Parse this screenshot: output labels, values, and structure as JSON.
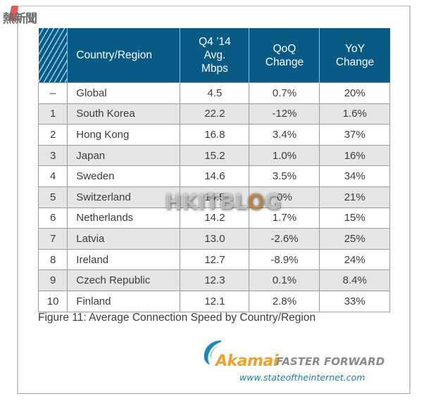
{
  "site_logo": {
    "text": "熱新聞"
  },
  "watermark": {
    "text_pre": "HKITBL",
    "text_o": "O",
    "text_post": "G"
  },
  "table": {
    "headers": {
      "rank": "",
      "country": "Country/Region",
      "avg_line1": "Q4 ’14",
      "avg_line2": "Avg.",
      "avg_line3": "Mbps",
      "qoq_line1": "QoQ",
      "qoq_line2": "Change",
      "yoy_line1": "YoY",
      "yoy_line2": "Change"
    },
    "rows": [
      {
        "rank": "–",
        "country": "Global",
        "mbps": "4.5",
        "qoq": "0.7%",
        "yoy": "20%"
      },
      {
        "rank": "1",
        "country": "South Korea",
        "mbps": "22.2",
        "qoq": "-12%",
        "yoy": "1.6%"
      },
      {
        "rank": "2",
        "country": "Hong Kong",
        "mbps": "16.8",
        "qoq": "3.4%",
        "yoy": "37%"
      },
      {
        "rank": "3",
        "country": "Japan",
        "mbps": "15.2",
        "qoq": "1.0%",
        "yoy": "16%"
      },
      {
        "rank": "4",
        "country": "Sweden",
        "mbps": "14.6",
        "qoq": "3.5%",
        "yoy": "34%"
      },
      {
        "rank": "5",
        "country": "Switzerland",
        "mbps": "14.5",
        "qoq": "0%",
        "yoy": "21%"
      },
      {
        "rank": "6",
        "country": "Netherlands",
        "mbps": "14.2",
        "qoq": "1.7%",
        "yoy": "15%"
      },
      {
        "rank": "7",
        "country": "Latvia",
        "mbps": "13.0",
        "qoq": "-2.6%",
        "yoy": "25%"
      },
      {
        "rank": "8",
        "country": "Ireland",
        "mbps": "12.7",
        "qoq": "-8.9%",
        "yoy": "24%"
      },
      {
        "rank": "9",
        "country": "Czech Republic",
        "mbps": "12.3",
        "qoq": "0.1%",
        "yoy": "8.4%"
      },
      {
        "rank": "10",
        "country": "Finland",
        "mbps": "12.1",
        "qoq": "2.8%",
        "yoy": "33%"
      }
    ]
  },
  "caption": "Figure 11: Average Connection Speed by Country/Region",
  "footer": {
    "brand": "Akamai",
    "tagline": "FASTER FORWARD",
    "url": "www.stateoftheinternet.com"
  },
  "colors": {
    "header_bg": "#0a5a86",
    "stripe": "#8fd3ee",
    "alt_row": "#e5e5e5",
    "brand_orange": "#f0a12d",
    "brand_blue": "#1c7fa6"
  }
}
